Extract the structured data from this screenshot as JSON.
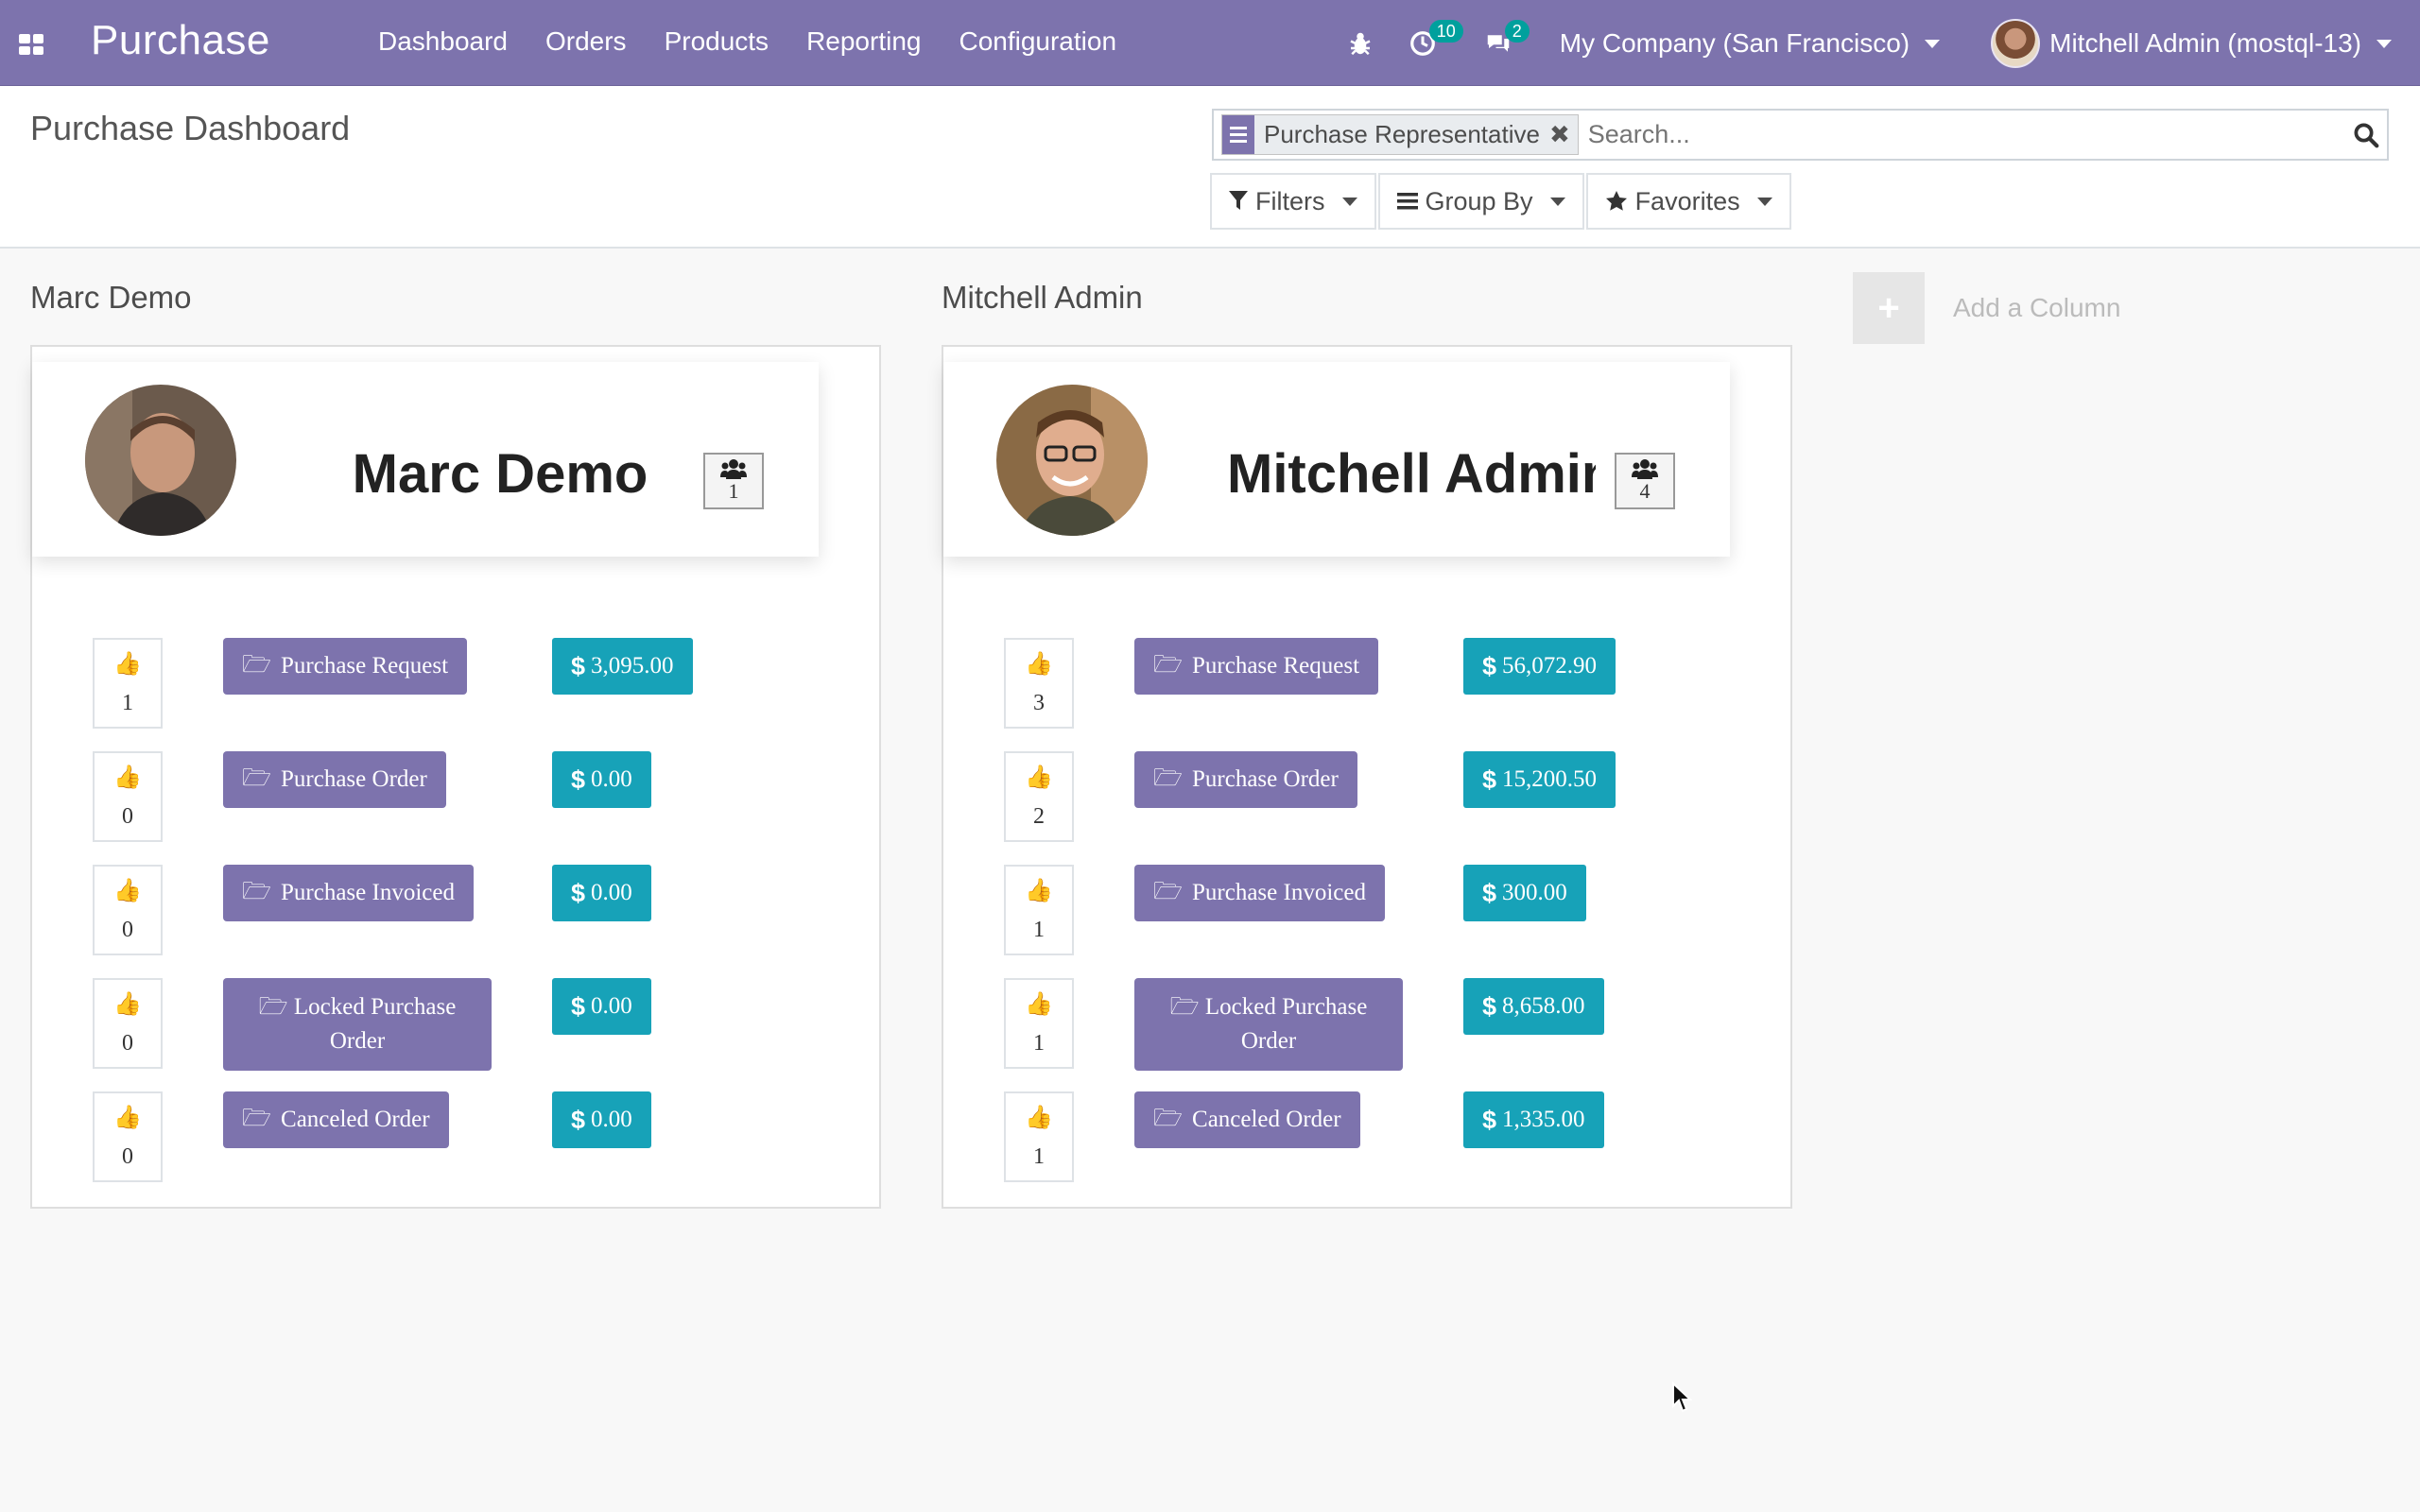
{
  "navbar": {
    "brand": "Purchase",
    "menu": [
      "Dashboard",
      "Orders",
      "Products",
      "Reporting",
      "Configuration"
    ],
    "activity_count": "10",
    "messages_count": "2",
    "company": "My Company (San Francisco)",
    "user": "Mitchell Admin (mostql-13)",
    "color": "#7d73ad"
  },
  "control_panel": {
    "breadcrumb": "Purchase Dashboard",
    "facet_label": "Purchase Representative",
    "search_placeholder": "Search...",
    "filters_label": "Filters",
    "groupby_label": "Group By",
    "favorites_label": "Favorites"
  },
  "columns": [
    {
      "title": "Marc Demo",
      "name": "Marc Demo",
      "team_count": "1",
      "rows": [
        {
          "likes": "1",
          "stage": "Purchase Request",
          "amount": "3,095.00"
        },
        {
          "likes": "0",
          "stage": "Purchase Order",
          "amount": "0.00"
        },
        {
          "likes": "0",
          "stage": "Purchase Invoiced",
          "amount": "0.00"
        },
        {
          "likes": "0",
          "stage": "Locked Purchase Order",
          "amount": "0.00"
        },
        {
          "likes": "0",
          "stage": "Canceled Order",
          "amount": "0.00"
        }
      ]
    },
    {
      "title": "Mitchell Admin",
      "name": "Mitchell Admin",
      "team_count": "4",
      "rows": [
        {
          "likes": "3",
          "stage": "Purchase Request",
          "amount": "56,072.90"
        },
        {
          "likes": "2",
          "stage": "Purchase Order",
          "amount": "15,200.50"
        },
        {
          "likes": "1",
          "stage": "Purchase Invoiced",
          "amount": "300.00"
        },
        {
          "likes": "1",
          "stage": "Locked Purchase Order",
          "amount": "8,658.00"
        },
        {
          "likes": "1",
          "stage": "Canceled Order",
          "amount": "1,335.00"
        }
      ]
    }
  ],
  "add_column_label": "Add a Column",
  "colors": {
    "stage": "#7d73ad",
    "amount": "#17a2b8",
    "badge": "#00a09d"
  },
  "currency_symbol": "$"
}
